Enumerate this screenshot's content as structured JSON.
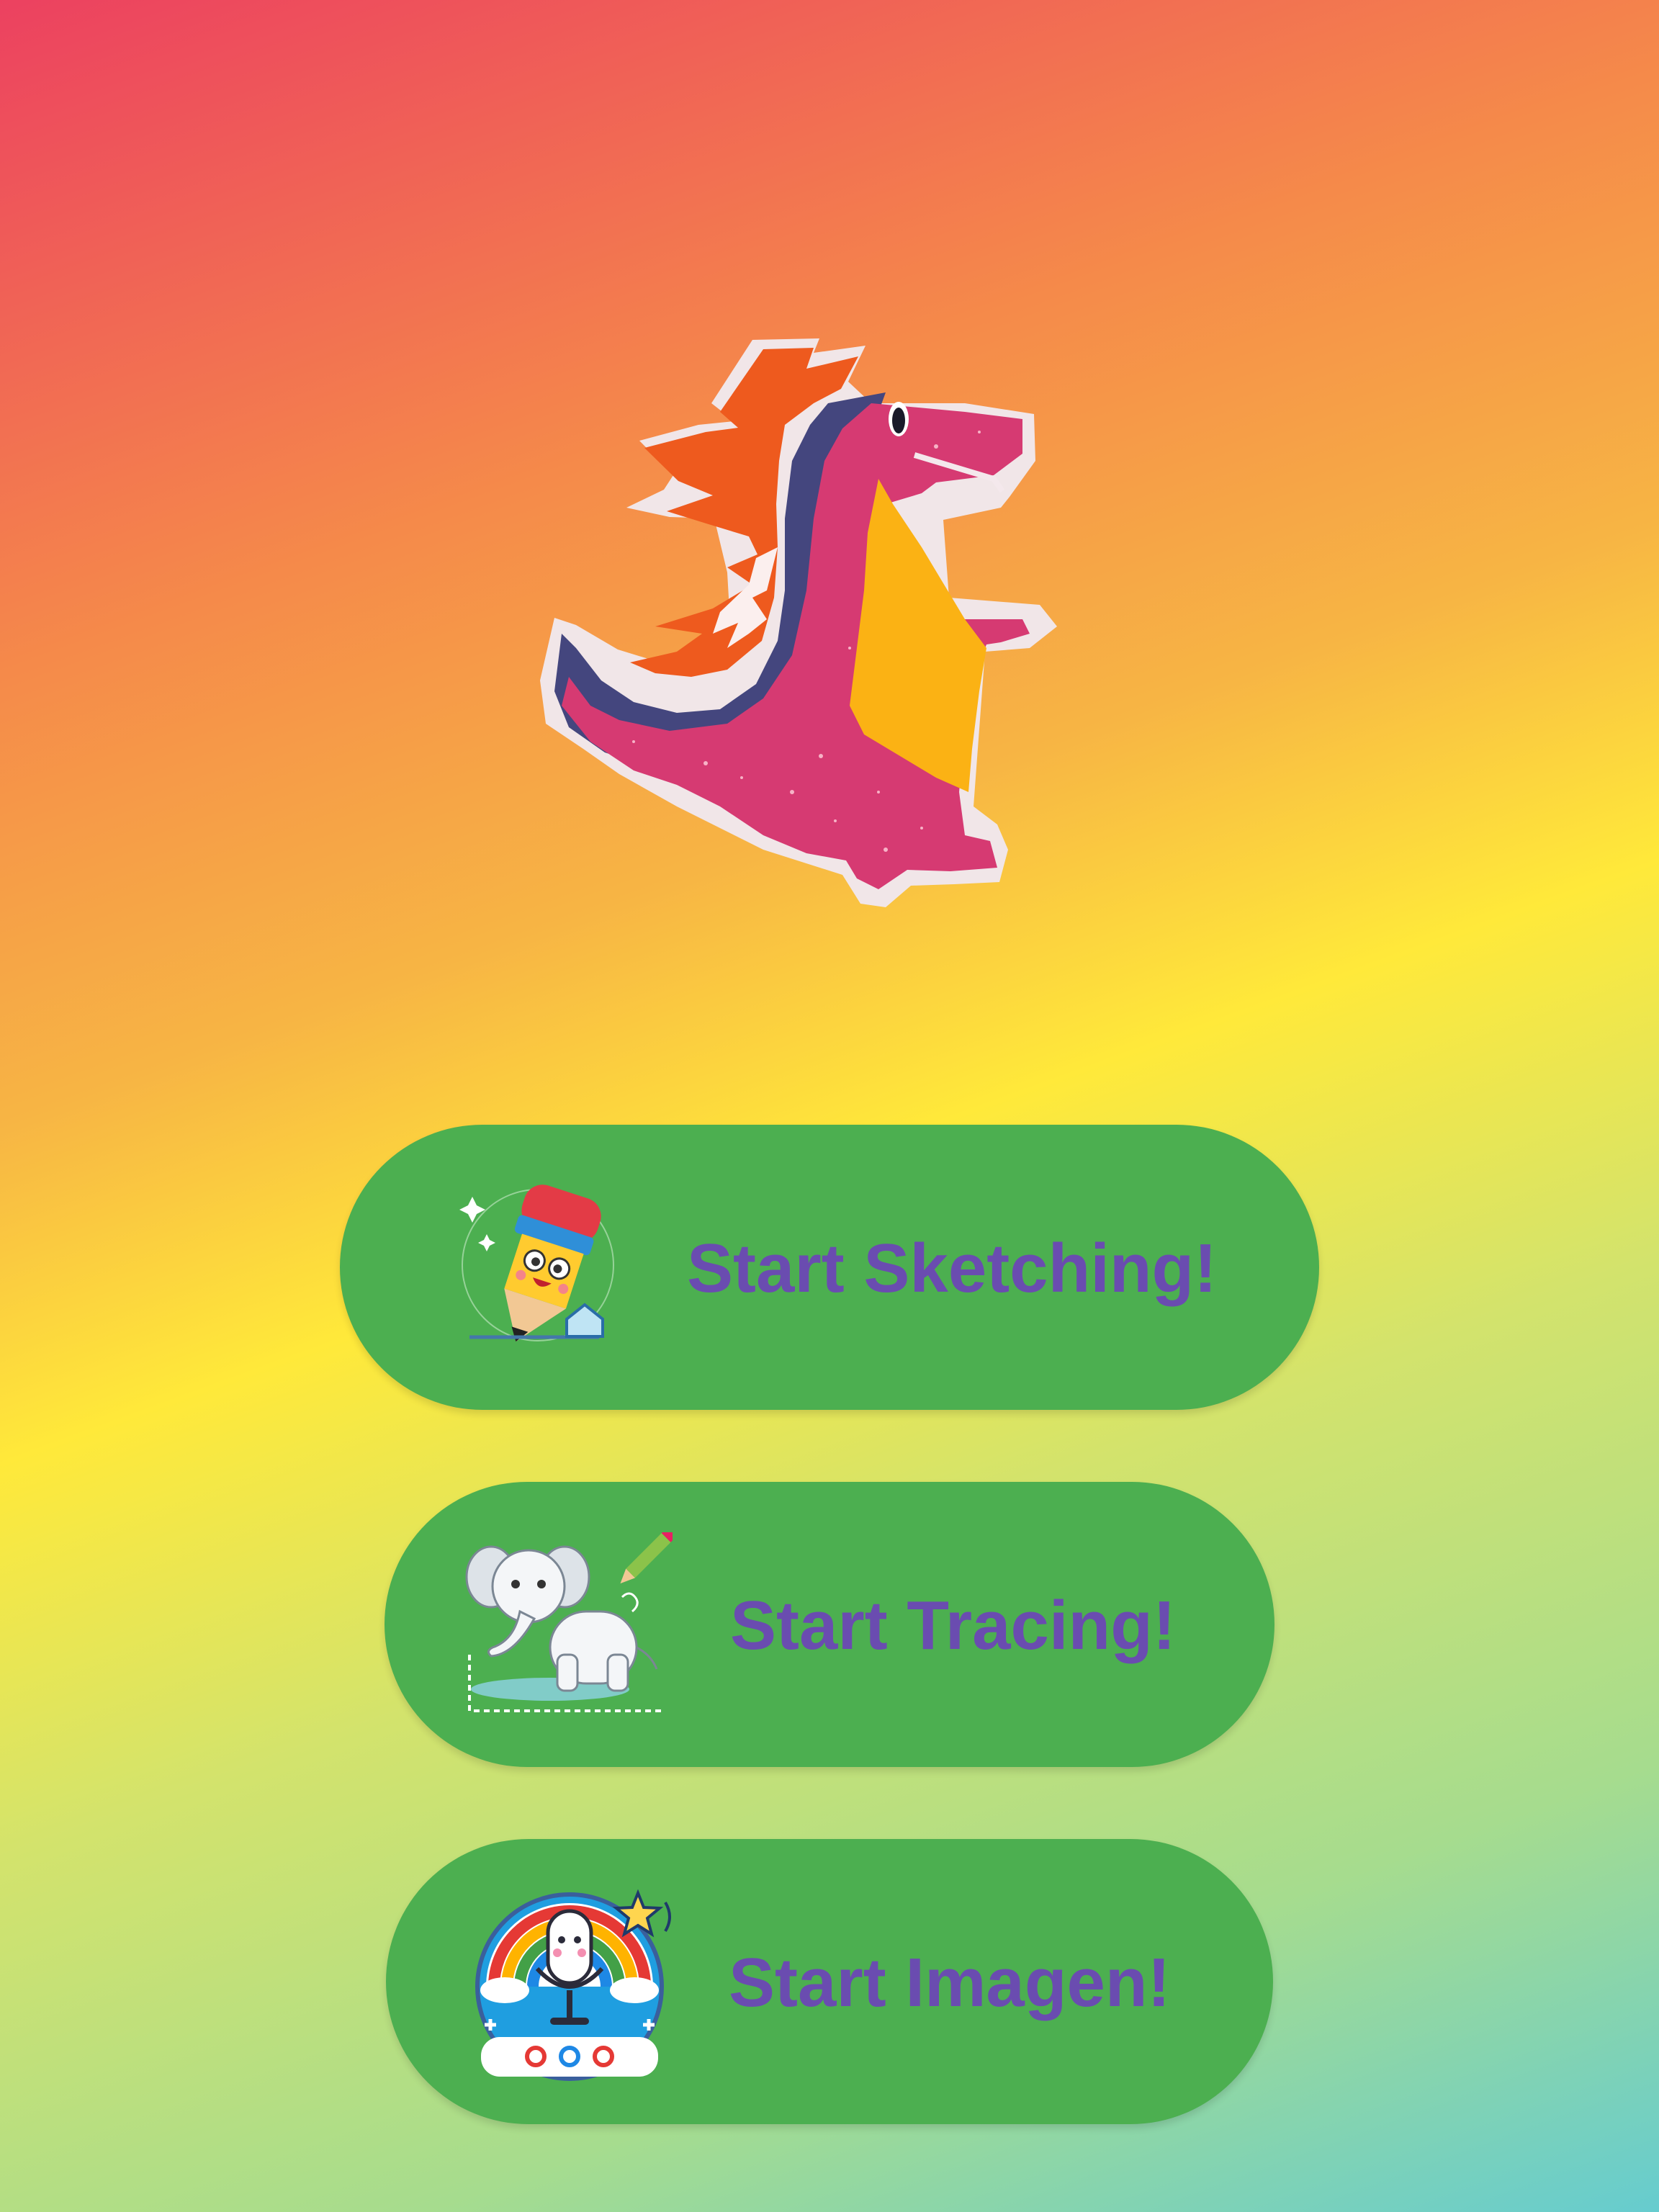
{
  "buttons": {
    "sketch": {
      "label": "Start Sketching!",
      "icon": "pencil-icon"
    },
    "trace": {
      "label": "Start Tracing!",
      "icon": "elephant-icon"
    },
    "imagen": {
      "label": "Start Imagen!",
      "icon": "microphone-icon"
    }
  },
  "mascot": {
    "icon": "dragon-icon"
  },
  "colors": {
    "button": "#4caf50",
    "label": "#6a4cb0",
    "gradient": [
      "#ec4160",
      "#f58a4a",
      "#ffe93a",
      "#a6dc8e",
      "#66cccf"
    ]
  }
}
